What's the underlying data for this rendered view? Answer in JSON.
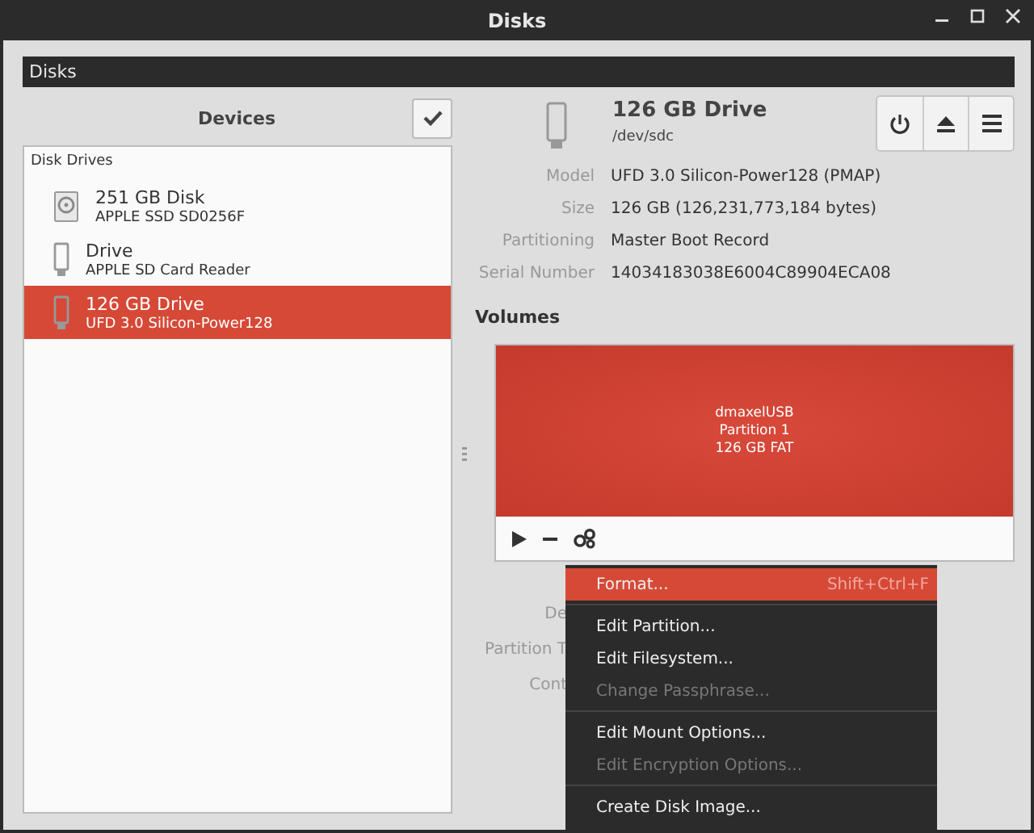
{
  "window": {
    "title": "Disks"
  },
  "header_bar": {
    "title": "Disks"
  },
  "devices": {
    "title": "Devices"
  },
  "drive_list": {
    "section": "Disk Drives",
    "items": [
      {
        "name": "251 GB Disk",
        "model": "APPLE SSD SD0256F",
        "kind": "hdd",
        "selected": false
      },
      {
        "name": "Drive",
        "model": "APPLE SD Card Reader",
        "kind": "flash",
        "selected": false
      },
      {
        "name": "126 GB Drive",
        "model": "UFD 3.0 Silicon-Power128",
        "kind": "flash",
        "selected": true
      }
    ]
  },
  "drive": {
    "name": "126 GB Drive",
    "path": "/dev/sdc",
    "fields": [
      {
        "label": "Model",
        "value": "UFD 3.0 Silicon-Power128 (PMAP)"
      },
      {
        "label": "Size",
        "value": "126 GB (126,231,773,184 bytes)"
      },
      {
        "label": "Partitioning",
        "value": "Master Boot Record"
      },
      {
        "label": "Serial Number",
        "value": "14034183038E6004C89904ECA08"
      }
    ]
  },
  "volumes": {
    "title": "Volumes",
    "partition": {
      "lines": [
        "dmaxelUSB",
        "Partition 1",
        "126 GB FAT"
      ],
      "selected": true
    },
    "detail_labels": [
      "De",
      "Partition T",
      "Cont"
    ]
  },
  "context_menu": {
    "items": [
      {
        "kind": "item",
        "label": "Format...",
        "shortcut": "Shift+Ctrl+F",
        "selected": true,
        "disabled": false
      },
      {
        "kind": "separator"
      },
      {
        "kind": "item",
        "label": "Edit Partition...",
        "selected": false,
        "disabled": false
      },
      {
        "kind": "item",
        "label": "Edit Filesystem...",
        "selected": false,
        "disabled": false
      },
      {
        "kind": "item",
        "label": "Change Passphrase...",
        "selected": false,
        "disabled": true
      },
      {
        "kind": "separator"
      },
      {
        "kind": "item",
        "label": "Edit Mount Options...",
        "selected": false,
        "disabled": false
      },
      {
        "kind": "item",
        "label": "Edit Encryption Options...",
        "selected": false,
        "disabled": true
      },
      {
        "kind": "separator"
      },
      {
        "kind": "item",
        "label": "Create Disk Image...",
        "selected": false,
        "disabled": false
      }
    ]
  }
}
